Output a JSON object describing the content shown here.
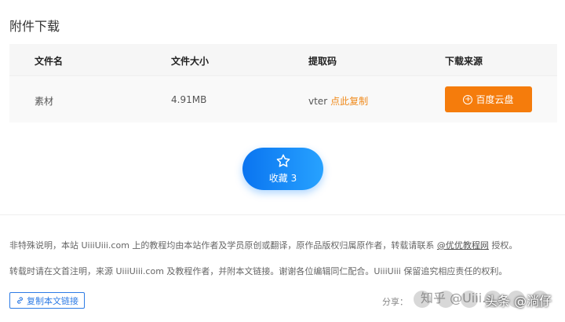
{
  "section_title": "附件下载",
  "table": {
    "headers": [
      "文件名",
      "文件大小",
      "提取码",
      "下载来源"
    ],
    "row": {
      "name": "素材",
      "size": "4.91MB",
      "code": "vter",
      "copy_label": "点此复制",
      "source_label": "百度云盘"
    }
  },
  "favorite": {
    "label": "收藏 3",
    "icon": "star-icon"
  },
  "notes": {
    "line1_a": "非特殊说明，本站 UiiiUiii.com 上的教程均由本站作者及学员原创或翻译，原作品版权归属原作者，转载请联系 ",
    "line1_link": "@优优教程网",
    "line1_b": " 授权。",
    "line2": "转载时请在文首注明，来源 UiiiUiii.com 及教程作者，并附本文链接。谢谢各位编辑同仁配合。UiiiUiii 保留追究相应责任的权利。"
  },
  "copy_link_button": "复制本文链接",
  "share_label": "分享：",
  "watermark": {
    "text1": "知乎 @Uiii…",
    "text2": "头条 @淌仔"
  },
  "colors": {
    "accent_orange": "#f57c0c",
    "accent_blue": "#0a74f0"
  }
}
